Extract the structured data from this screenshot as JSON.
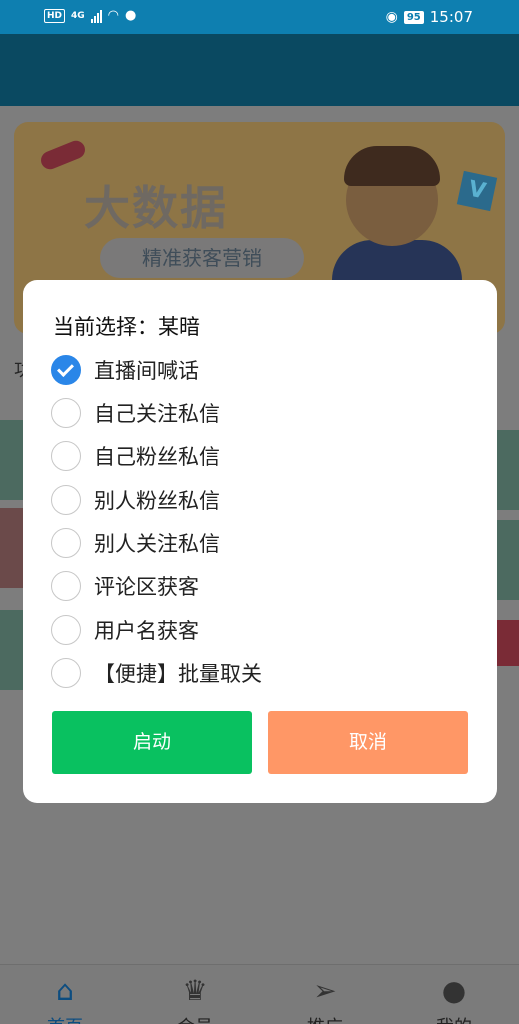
{
  "status_bar": {
    "hd_badge": "HD",
    "network": "4G",
    "battery": "95",
    "time": "15:07"
  },
  "banner": {
    "title": "大数据",
    "subtitle": "精准获客营销",
    "badge": "V"
  },
  "background_text": "功",
  "dialog": {
    "title": "当前选择：某暗",
    "options": [
      {
        "label": "直播间喊话",
        "checked": true
      },
      {
        "label": "自己关注私信",
        "checked": false
      },
      {
        "label": "自己粉丝私信",
        "checked": false
      },
      {
        "label": "别人粉丝私信",
        "checked": false
      },
      {
        "label": "别人关注私信",
        "checked": false
      },
      {
        "label": "评论区获客",
        "checked": false
      },
      {
        "label": "用户名获客",
        "checked": false
      },
      {
        "label": "【便捷】批量取关",
        "checked": false
      }
    ],
    "start_label": "启动",
    "cancel_label": "取消"
  },
  "tab_bar": {
    "tabs": [
      {
        "label": "首页",
        "icon": "home-icon",
        "active": true
      },
      {
        "label": "会员",
        "icon": "crown-icon",
        "active": false
      },
      {
        "label": "推广",
        "icon": "paper-plane-icon",
        "active": false
      },
      {
        "label": "我的",
        "icon": "user-icon",
        "active": false
      }
    ]
  },
  "colors": {
    "check_blue": "#2a86e8",
    "start_green": "#09c160",
    "cancel_orange": "#ff9766",
    "status_bar": "#0e7fb0"
  }
}
